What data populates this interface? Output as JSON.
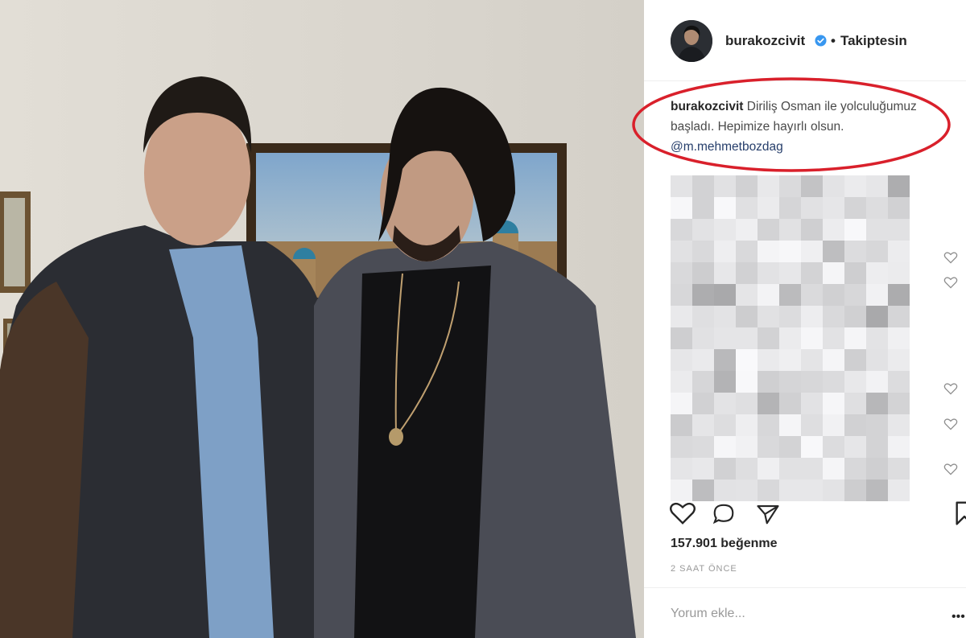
{
  "post": {
    "username": "burakozcivit",
    "follow_status": "Takiptesin",
    "follow_dot": "•",
    "caption_user": "burakozcivit",
    "caption_text": " Diriliş Osman ile yolculuğumuz başladı. Hepimize hayırlı olsun. ",
    "caption_mention": "@m.mehmetbozdag",
    "likes": "157.901 beğenme",
    "time": "2 SAAT ÖNCE",
    "comment_placeholder": "Yorum ekle...",
    "more": "•••"
  },
  "icons": {
    "verified": "verified-badge-icon",
    "like": "heart-icon",
    "comment": "comment-icon",
    "share": "share-icon",
    "save": "bookmark-icon"
  },
  "colors": {
    "verified_blue": "#3897f0",
    "annotation_red": "#d9202b",
    "mention": "#263e6b"
  }
}
